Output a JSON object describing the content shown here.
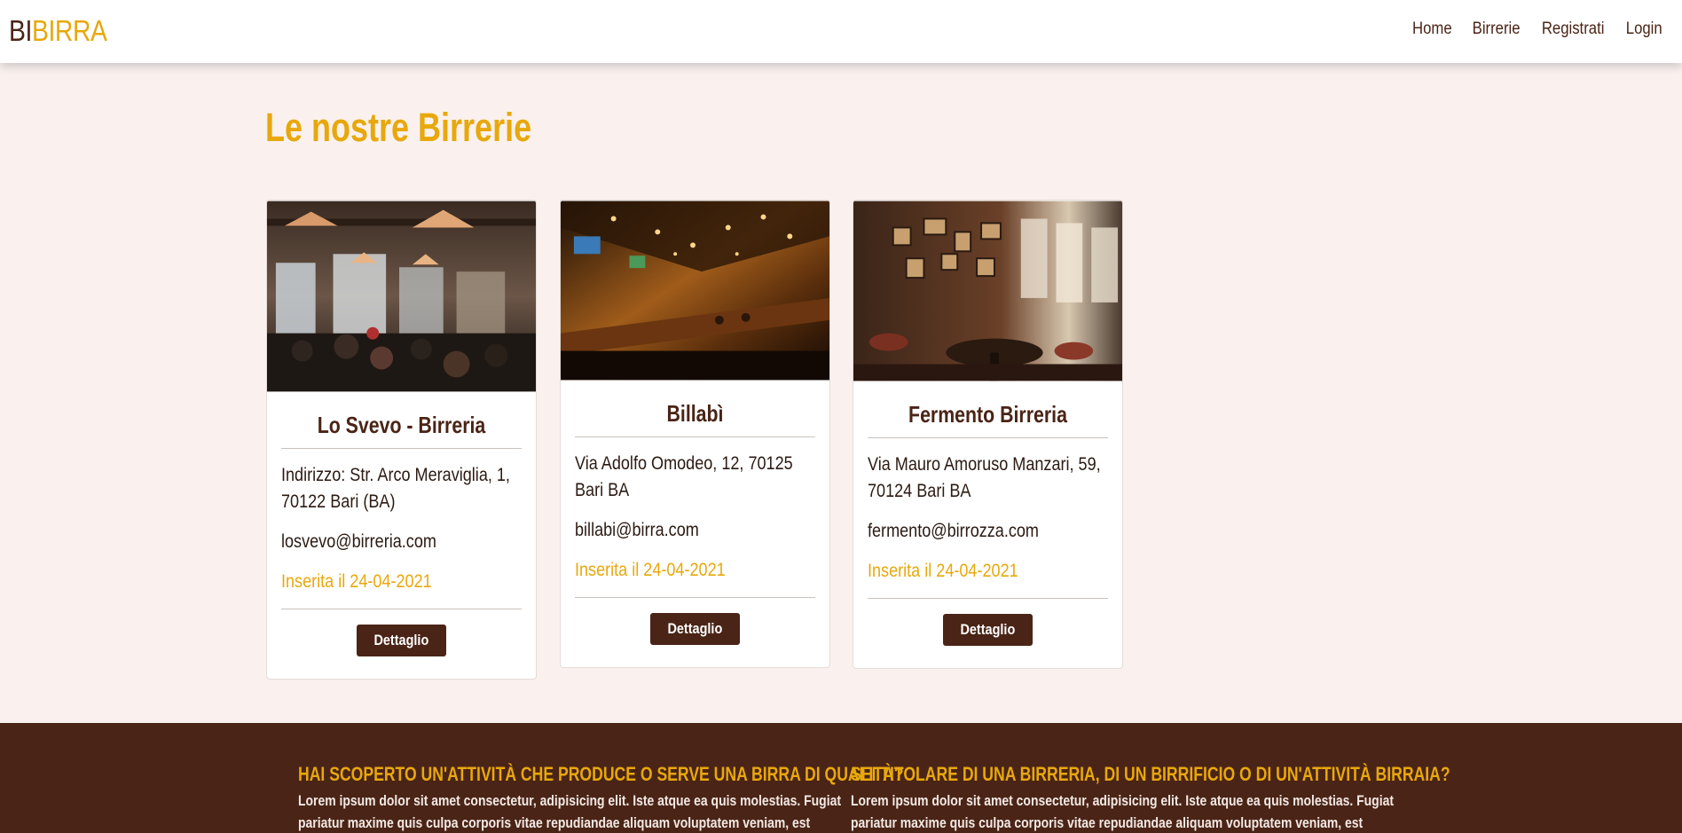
{
  "brand": {
    "part1": "BI",
    "part2": "BIRRA"
  },
  "nav": {
    "items": [
      "Home",
      "Birrerie",
      "Registrati",
      "Login"
    ]
  },
  "main": {
    "title": "Le nostre Birrerie"
  },
  "cards": [
    {
      "name": "Lo Svevo - Birreria",
      "address": "Indirizzo: Str. Arco Meraviglia, 1, 70122 Bari (BA)",
      "email": "losvevo@birreria.com",
      "date": "Inserita il 24-04-2021",
      "button": "Dettaglio"
    },
    {
      "name": "Billabì",
      "address": "Via Adolfo Omodeo, 12, 70125 Bari BA",
      "email": "billabi@birra.com",
      "date": "Inserita il 24-04-2021",
      "button": "Dettaglio"
    },
    {
      "name": "Fermento Birreria",
      "address": "Via Mauro Amoruso Manzari, 59, 70124 Bari BA",
      "email": "fermento@birrozza.com",
      "date": "Inserita il 24-04-2021",
      "button": "Dettaglio"
    }
  ],
  "footer": {
    "col1": {
      "heading": "HAI SCOPERTO UN'ATTIVITÀ CHE PRODUCE O SERVE UNA BIRRA DI QUALITÀ?",
      "text": "Lorem ipsum dolor sit amet consectetur, adipisicing elit. Iste atque ea quis molestias. Fugiat pariatur maxime quis culpa corporis vitae repudiandae aliquam voluptatem veniam, est atque cumque eum"
    },
    "col2": {
      "heading": "SEI TITOLARE DI UNA BIRRERIA, DI UN BIRRIFICIO O DI UN'ATTIVITÀ BIRRAIA?",
      "text": "Lorem ipsum dolor sit amet consectetur, adipisicing elit. Iste atque ea quis molestias. Fugiat pariatur maxime quis culpa corporis vitae repudiandae aliquam voluptatem veniam, est atque cumque eum"
    }
  },
  "colors": {
    "accent": "#e8a80c",
    "brand_dark": "#4a2416",
    "background": "#faf1ee"
  }
}
